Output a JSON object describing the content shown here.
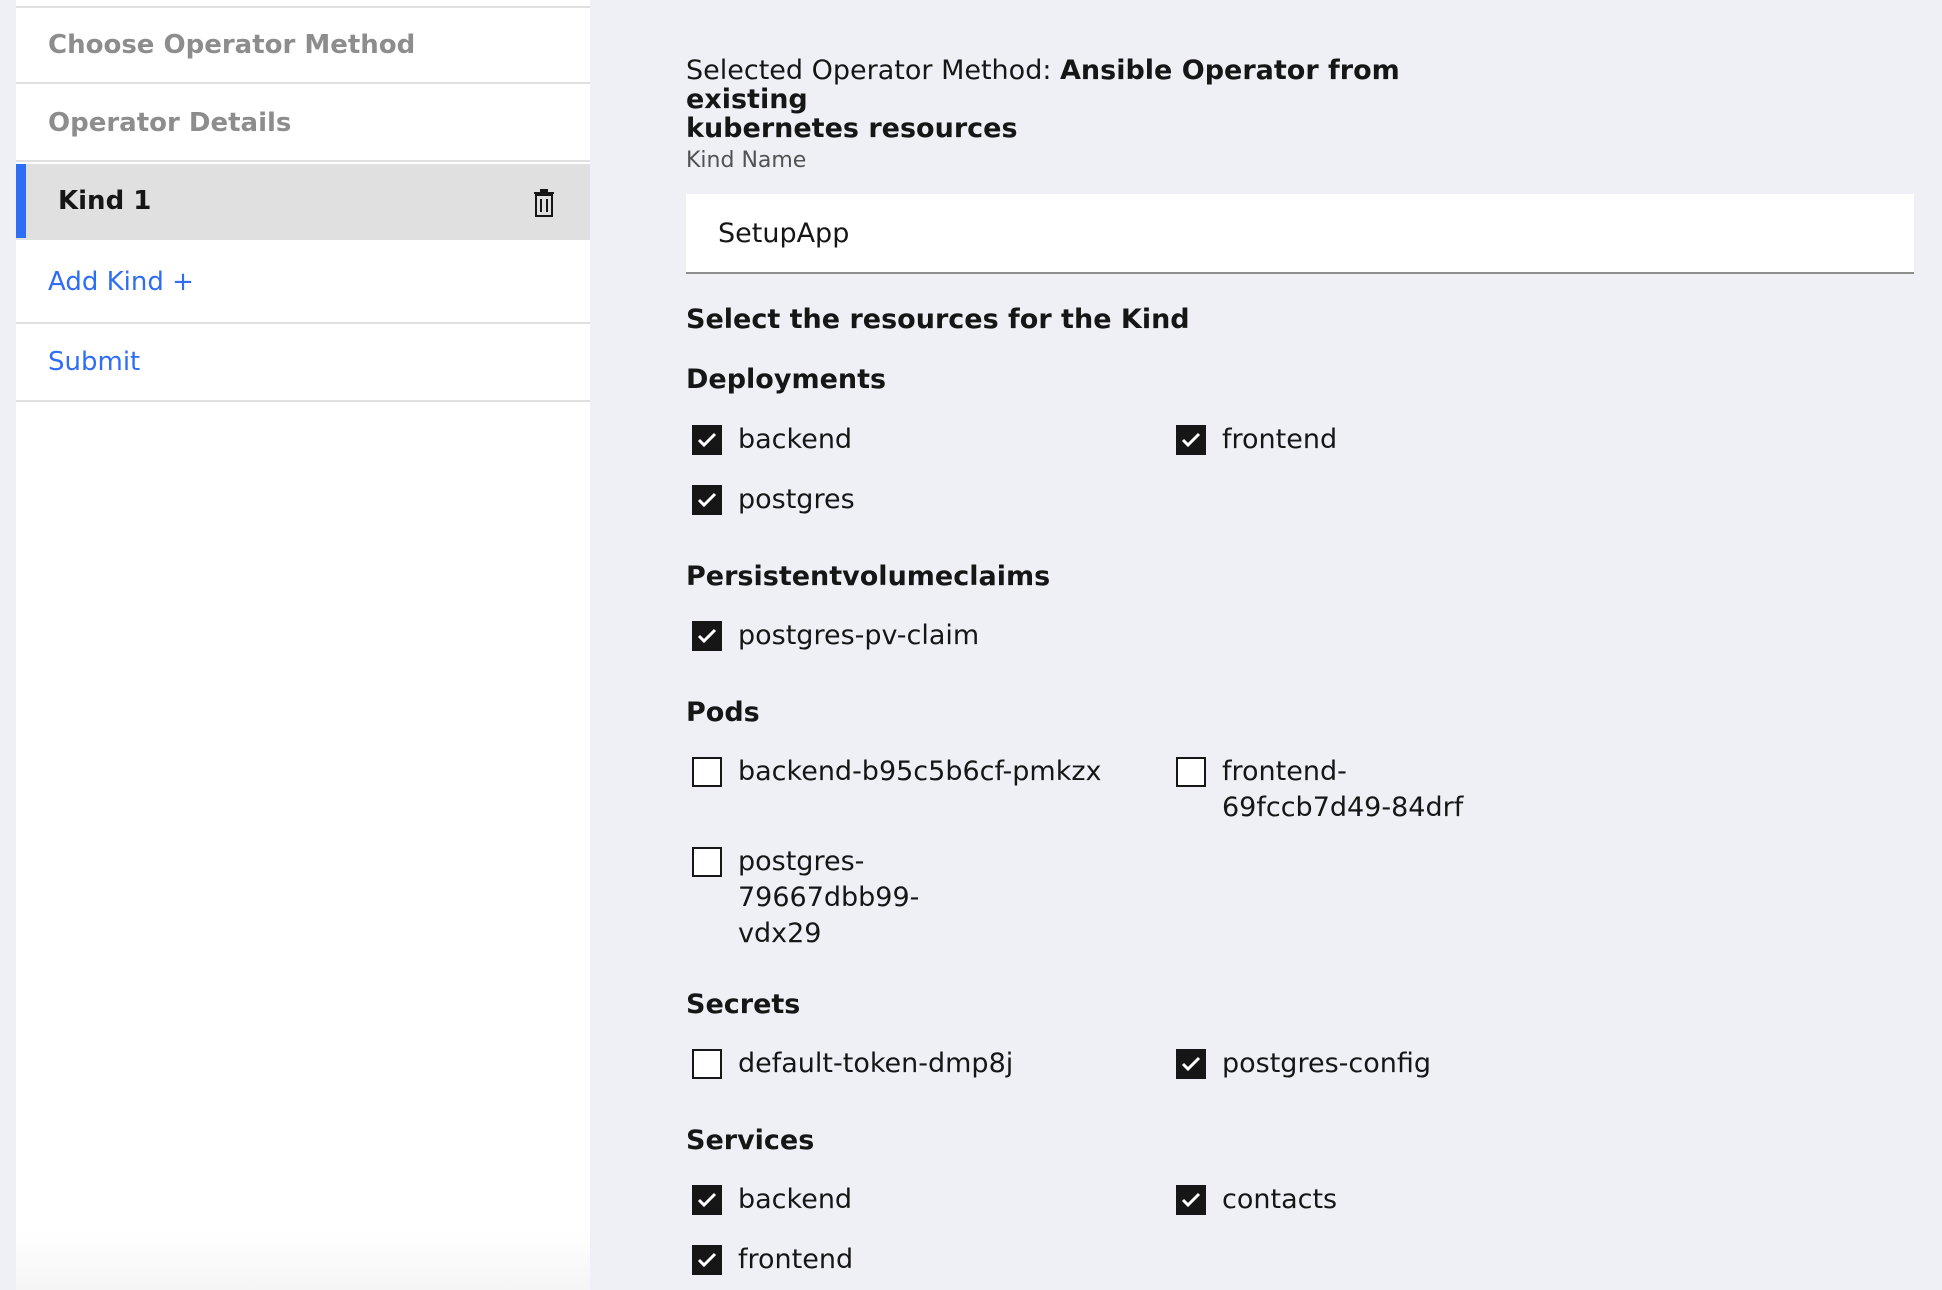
{
  "sidebar": {
    "items": [
      {
        "label": "Choose Operator Method"
      },
      {
        "label": "Operator Details"
      },
      {
        "label": "Kind 1"
      },
      {
        "label": "Add Kind +"
      },
      {
        "label": "Submit"
      }
    ],
    "active_accent": "#2f6df5"
  },
  "main": {
    "method_prefix": "Selected Operator Method: ",
    "method_value_line1": "Ansible Operator from existing",
    "method_value_line2": "kubernetes resources",
    "kind_name_label": "Kind Name",
    "kind_name_value": "SetupApp",
    "select_heading": "Select the resources for the Kind",
    "groups": [
      {
        "title": "Deployments",
        "items": [
          {
            "label": "backend",
            "checked": true
          },
          {
            "label": "frontend",
            "checked": true
          },
          {
            "label": "postgres",
            "checked": true
          }
        ]
      },
      {
        "title": "Persistentvolumeclaims",
        "items": [
          {
            "label": "postgres-pv-claim",
            "checked": true
          }
        ]
      },
      {
        "title": "Pods",
        "items": [
          {
            "label": "backend-b95c5b6cf-pmkzx",
            "checked": false
          },
          {
            "label_lines": [
              "frontend-",
              "69fccb7d49-84drf"
            ],
            "checked": false
          },
          {
            "label_lines": [
              "postgres-",
              "79667dbb99-",
              "vdx29"
            ],
            "checked": false
          }
        ]
      },
      {
        "title": "Secrets",
        "items": [
          {
            "label": "default-token-dmp8j",
            "checked": false
          },
          {
            "label": "postgres-config",
            "checked": true
          }
        ]
      },
      {
        "title": "Services",
        "items": [
          {
            "label": "backend",
            "checked": true
          },
          {
            "label": "contacts",
            "checked": true
          },
          {
            "label": "frontend",
            "checked": true
          }
        ]
      }
    ]
  },
  "icons": {
    "delete": "trash-icon",
    "check": "checkmark-icon"
  }
}
